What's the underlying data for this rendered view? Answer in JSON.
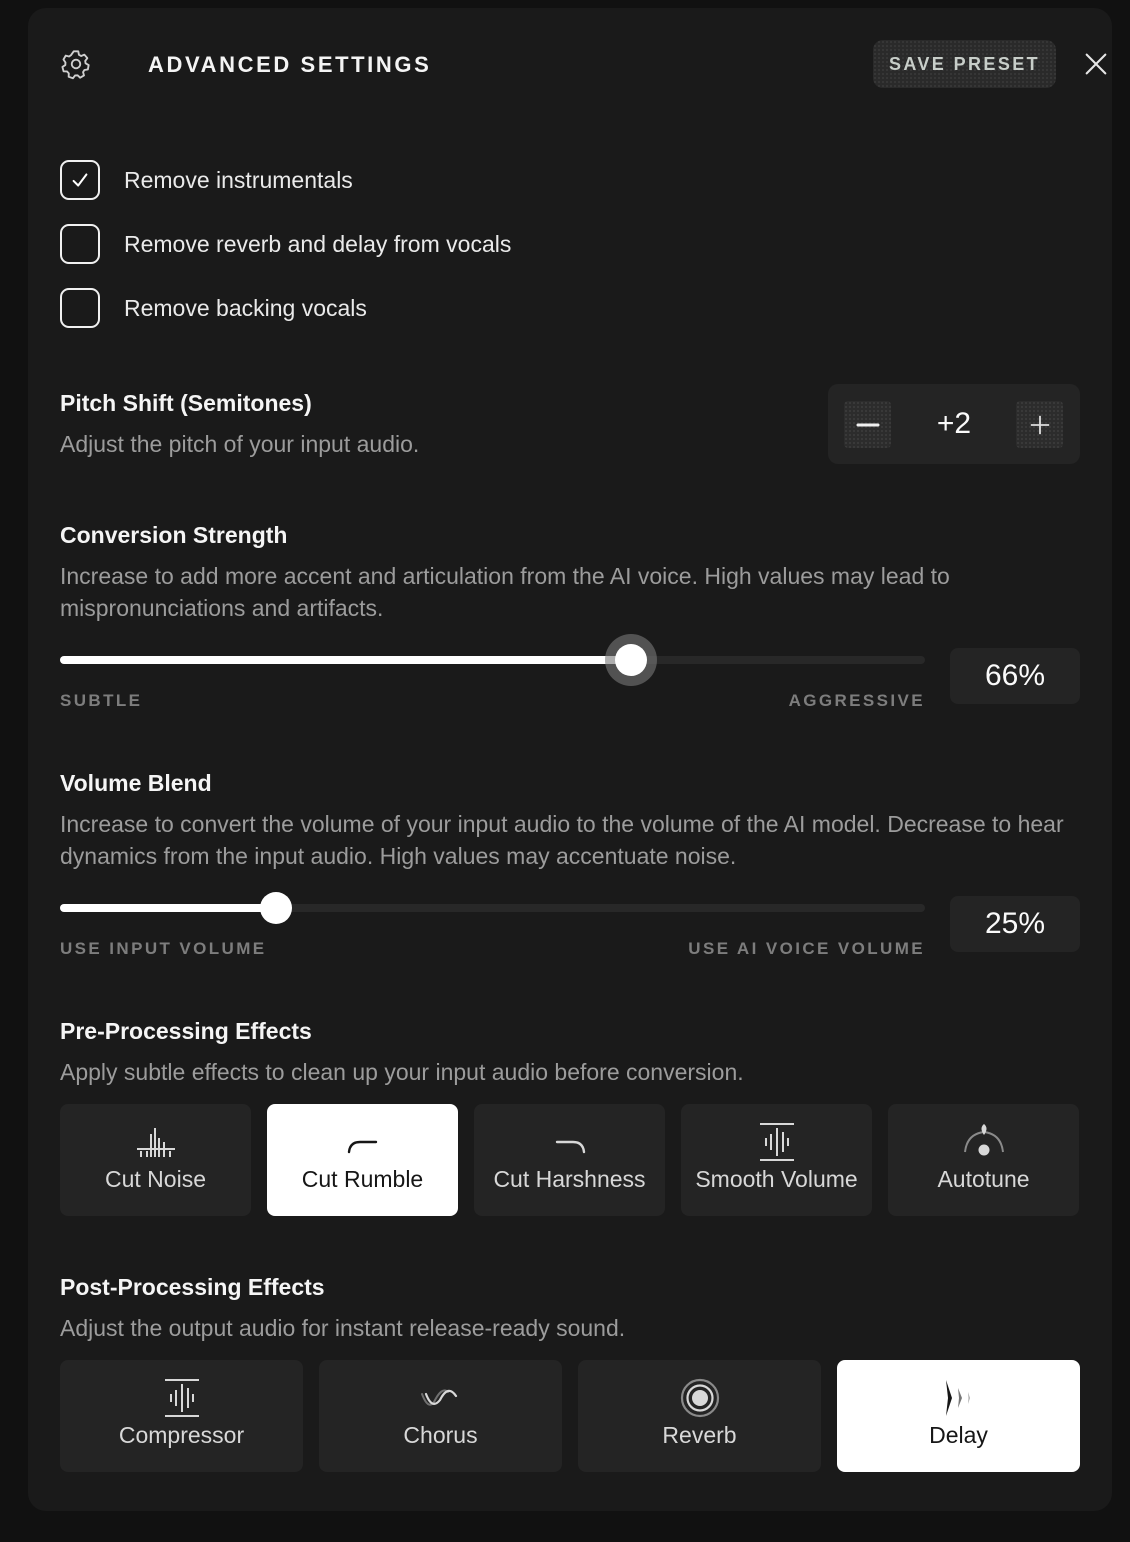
{
  "header": {
    "title": "ADVANCED SETTINGS",
    "save_preset_label": "SAVE PRESET"
  },
  "options": [
    {
      "label": "Remove instrumentals",
      "checked": true
    },
    {
      "label": "Remove reverb and delay from vocals",
      "checked": false
    },
    {
      "label": "Remove backing vocals",
      "checked": false
    }
  ],
  "pitch_shift": {
    "title": "Pitch Shift (Semitones)",
    "description": "Adjust the pitch of your input audio.",
    "value": "+2"
  },
  "conversion_strength": {
    "title": "Conversion Strength",
    "description": "Increase to add more accent and articulation from the AI voice. High values may lead to mispronunciations and artifacts.",
    "value_percent": 66,
    "value_label": "66%",
    "min_label": "SUBTLE",
    "max_label": "AGGRESSIVE"
  },
  "volume_blend": {
    "title": "Volume Blend",
    "description": "Increase to convert the volume of your input audio to the volume of the AI model. Decrease to hear dynamics from the input audio. High values may accentuate noise.",
    "value_percent": 25,
    "value_label": "25%",
    "min_label": "USE INPUT VOLUME",
    "max_label": "USE AI VOICE VOLUME"
  },
  "pre_processing": {
    "title": "Pre-Processing Effects",
    "description": "Apply subtle effects to clean up your input audio before conversion.",
    "effects": [
      {
        "label": "Cut Noise",
        "icon": "noise-gate-icon",
        "active": false
      },
      {
        "label": "Cut Rumble",
        "icon": "high-pass-icon",
        "active": true
      },
      {
        "label": "Cut Harshness",
        "icon": "low-pass-icon",
        "active": false
      },
      {
        "label": "Smooth Volume",
        "icon": "compressor-icon",
        "active": false
      },
      {
        "label": "Autotune",
        "icon": "autotune-icon",
        "active": false
      }
    ]
  },
  "post_processing": {
    "title": "Post-Processing Effects",
    "description": "Adjust the output audio for instant release-ready sound.",
    "effects": [
      {
        "label": "Compressor",
        "icon": "compressor-icon",
        "active": false
      },
      {
        "label": "Chorus",
        "icon": "chorus-wave-icon",
        "active": false
      },
      {
        "label": "Reverb",
        "icon": "reverb-rings-icon",
        "active": false
      },
      {
        "label": "Delay",
        "icon": "delay-echo-icon",
        "active": true
      }
    ]
  },
  "colors": {
    "background": "#111111",
    "panel": "#1a1a1a",
    "card": "#242424",
    "active_card": "#ffffff",
    "muted_text": "#9c9c9c"
  }
}
